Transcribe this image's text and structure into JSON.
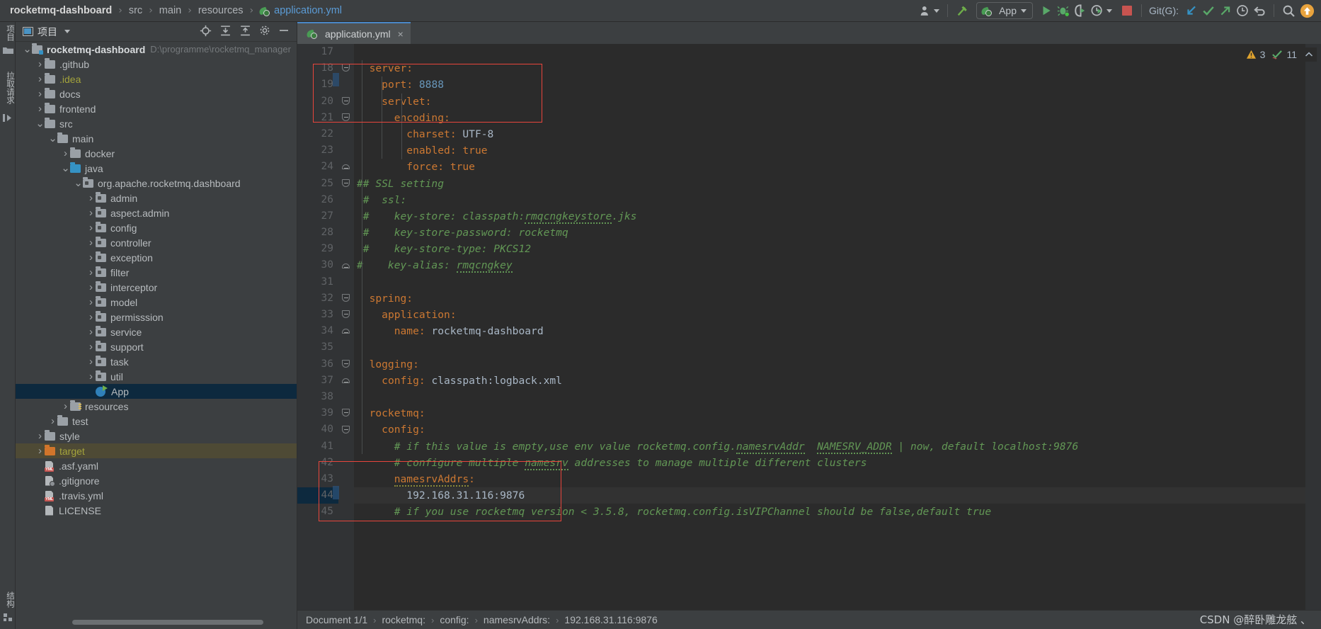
{
  "breadcrumb": {
    "items": [
      "rocketmq-dashboard",
      "src",
      "main",
      "resources",
      "application.yml"
    ],
    "separator": "›",
    "file_icon": "yaml-leaf-icon"
  },
  "toolbar": {
    "user_icon": "user-account-icon",
    "build_icon": "build-hammer-icon",
    "run_config_label": "App",
    "run_config_icon": "spring-leaf-icon",
    "run_icon": "run-play-icon",
    "debug_icon": "debug-bug-icon",
    "run_coverage_icon": "run-with-coverage-icon",
    "profiler_icon": "profiler-clock-icon",
    "stop_icon": "stop-square-icon",
    "git_label": "Git(G):",
    "git_update_icon": "git-update-arrow-icon",
    "git_commit_icon": "git-commit-check-icon",
    "git_push_icon": "git-push-arrow-icon",
    "git_history_icon": "git-history-clock-icon",
    "git_rollback_icon": "git-rollback-icon",
    "search_icon": "search-magnifier-icon",
    "notification_icon": "update-notification-icon"
  },
  "left_strip": {
    "tabs": [
      "项目",
      "拉取请求"
    ],
    "bottom_tabs": [
      "结构"
    ]
  },
  "project_panel": {
    "title": "项目",
    "header_icons": [
      "locate-target-icon",
      "expand-all-icon",
      "collapse-all-icon",
      "settings-gear-icon",
      "hide-minus-icon"
    ],
    "tree": [
      {
        "indent": 0,
        "arrow": "down",
        "icon": "module-folder",
        "label": "rocketmq-dashboard",
        "bold": true,
        "path": "D:\\programme\\rocketmq_manager"
      },
      {
        "indent": 1,
        "arrow": "right",
        "icon": "folder",
        "label": ".github"
      },
      {
        "indent": 1,
        "arrow": "right",
        "icon": "folder",
        "label": ".idea",
        "color": "yellow"
      },
      {
        "indent": 1,
        "arrow": "right",
        "icon": "folder",
        "label": "docs"
      },
      {
        "indent": 1,
        "arrow": "right",
        "icon": "folder",
        "label": "frontend"
      },
      {
        "indent": 1,
        "arrow": "down",
        "icon": "folder",
        "label": "src"
      },
      {
        "indent": 2,
        "arrow": "down",
        "icon": "folder",
        "label": "main"
      },
      {
        "indent": 3,
        "arrow": "right",
        "icon": "folder",
        "label": "docker"
      },
      {
        "indent": 3,
        "arrow": "down",
        "icon": "source-folder",
        "label": "java"
      },
      {
        "indent": 4,
        "arrow": "down",
        "icon": "package",
        "label": "org.apache.rocketmq.dashboard"
      },
      {
        "indent": 5,
        "arrow": "right",
        "icon": "package",
        "label": "admin"
      },
      {
        "indent": 5,
        "arrow": "right",
        "icon": "package",
        "label": "aspect.admin"
      },
      {
        "indent": 5,
        "arrow": "right",
        "icon": "package",
        "label": "config"
      },
      {
        "indent": 5,
        "arrow": "right",
        "icon": "package",
        "label": "controller"
      },
      {
        "indent": 5,
        "arrow": "right",
        "icon": "package",
        "label": "exception"
      },
      {
        "indent": 5,
        "arrow": "right",
        "icon": "package",
        "label": "filter"
      },
      {
        "indent": 5,
        "arrow": "right",
        "icon": "package",
        "label": "interceptor"
      },
      {
        "indent": 5,
        "arrow": "right",
        "icon": "package",
        "label": "model"
      },
      {
        "indent": 5,
        "arrow": "right",
        "icon": "package",
        "label": "permisssion"
      },
      {
        "indent": 5,
        "arrow": "right",
        "icon": "package",
        "label": "service"
      },
      {
        "indent": 5,
        "arrow": "right",
        "icon": "package",
        "label": "support"
      },
      {
        "indent": 5,
        "arrow": "right",
        "icon": "package",
        "label": "task"
      },
      {
        "indent": 5,
        "arrow": "right",
        "icon": "package",
        "label": "util"
      },
      {
        "indent": 5,
        "arrow": "none",
        "icon": "spring-class",
        "label": "App",
        "selected": true
      },
      {
        "indent": 3,
        "arrow": "right",
        "icon": "resource-folder",
        "label": "resources"
      },
      {
        "indent": 2,
        "arrow": "right",
        "icon": "folder",
        "label": "test"
      },
      {
        "indent": 1,
        "arrow": "right",
        "icon": "folder",
        "label": "style"
      },
      {
        "indent": 1,
        "arrow": "right",
        "icon": "target-folder",
        "label": "target",
        "color": "yellow",
        "highlighted": true
      },
      {
        "indent": 1,
        "arrow": "none",
        "icon": "yml-file",
        "label": ".asf.yaml"
      },
      {
        "indent": 1,
        "arrow": "none",
        "icon": "gitignore-file",
        "label": ".gitignore"
      },
      {
        "indent": 1,
        "arrow": "none",
        "icon": "yml-file",
        "label": ".travis.yml"
      },
      {
        "indent": 1,
        "arrow": "none",
        "icon": "text-file",
        "label": "LICENSE"
      }
    ]
  },
  "editor": {
    "tab": {
      "label": "application.yml",
      "icon": "yaml-leaf-icon",
      "close": "×"
    },
    "inspection": {
      "warning_icon": "warning-triangle-icon",
      "warning_count": "3",
      "ok_icon": "inspection-check-icon",
      "ok_count": "11",
      "collapse_icon": "chevron-up-icon"
    },
    "first_line": 17,
    "current_line": 44,
    "lines": [
      {
        "n": 17,
        "fold": "",
        "text": ""
      },
      {
        "n": 18,
        "fold": "open",
        "segs": [
          {
            "t": "  ",
            "c": ""
          },
          {
            "t": "server",
            "c": "key"
          },
          {
            "t": ":",
            "c": "key"
          }
        ]
      },
      {
        "n": 19,
        "fold": "",
        "segs": [
          {
            "t": "    ",
            "c": ""
          },
          {
            "t": "port",
            "c": "key"
          },
          {
            "t": ": ",
            "c": "key"
          },
          {
            "t": "8888",
            "c": "num"
          }
        ]
      },
      {
        "n": 20,
        "fold": "open",
        "segs": [
          {
            "t": "    ",
            "c": ""
          },
          {
            "t": "servlet",
            "c": "key"
          },
          {
            "t": ":",
            "c": "key"
          }
        ]
      },
      {
        "n": 21,
        "fold": "open",
        "segs": [
          {
            "t": "      ",
            "c": ""
          },
          {
            "t": "encoding",
            "c": "key"
          },
          {
            "t": ":",
            "c": "key"
          }
        ]
      },
      {
        "n": 22,
        "fold": "",
        "segs": [
          {
            "t": "        ",
            "c": ""
          },
          {
            "t": "charset",
            "c": "key"
          },
          {
            "t": ": ",
            "c": "key"
          },
          {
            "t": "UTF-8",
            "c": "val"
          }
        ]
      },
      {
        "n": 23,
        "fold": "",
        "segs": [
          {
            "t": "        ",
            "c": ""
          },
          {
            "t": "enabled",
            "c": "key"
          },
          {
            "t": ": ",
            "c": "key"
          },
          {
            "t": "true",
            "c": "key"
          }
        ]
      },
      {
        "n": 24,
        "fold": "end",
        "segs": [
          {
            "t": "        ",
            "c": ""
          },
          {
            "t": "force",
            "c": "key"
          },
          {
            "t": ": ",
            "c": "key"
          },
          {
            "t": "true",
            "c": "key"
          }
        ]
      },
      {
        "n": 25,
        "fold": "open",
        "segs": [
          {
            "t": "## SSL setting",
            "c": "cmt"
          }
        ]
      },
      {
        "n": 26,
        "fold": "",
        "segs": [
          {
            "t": " #  ssl:",
            "c": "cmt"
          }
        ]
      },
      {
        "n": 27,
        "fold": "",
        "segs": [
          {
            "t": " #    key-store: classpath:",
            "c": "cmt"
          },
          {
            "t": "rmqcngkeystore",
            "c": "cmt sq"
          },
          {
            "t": ".jks",
            "c": "cmt"
          }
        ]
      },
      {
        "n": 28,
        "fold": "",
        "segs": [
          {
            "t": " #    key-store-password: rocketmq",
            "c": "cmt"
          }
        ]
      },
      {
        "n": 29,
        "fold": "",
        "segs": [
          {
            "t": " #    key-store-type: PKCS12",
            "c": "cmt"
          }
        ]
      },
      {
        "n": 30,
        "fold": "end",
        "segs": [
          {
            "t": "#    key-alias: ",
            "c": "cmt"
          },
          {
            "t": "rmqcngkey",
            "c": "cmt sq"
          }
        ]
      },
      {
        "n": 31,
        "fold": "",
        "text": ""
      },
      {
        "n": 32,
        "fold": "open",
        "segs": [
          {
            "t": "  ",
            "c": ""
          },
          {
            "t": "spring",
            "c": "key"
          },
          {
            "t": ":",
            "c": "key"
          }
        ]
      },
      {
        "n": 33,
        "fold": "open",
        "segs": [
          {
            "t": "    ",
            "c": ""
          },
          {
            "t": "application",
            "c": "key"
          },
          {
            "t": ":",
            "c": "key"
          }
        ]
      },
      {
        "n": 34,
        "fold": "end",
        "segs": [
          {
            "t": "      ",
            "c": ""
          },
          {
            "t": "name",
            "c": "key"
          },
          {
            "t": ": ",
            "c": "key"
          },
          {
            "t": "rocketmq-dashboard",
            "c": "val"
          }
        ]
      },
      {
        "n": 35,
        "fold": "",
        "text": ""
      },
      {
        "n": 36,
        "fold": "open",
        "segs": [
          {
            "t": "  ",
            "c": ""
          },
          {
            "t": "logging",
            "c": "key"
          },
          {
            "t": ":",
            "c": "key"
          }
        ]
      },
      {
        "n": 37,
        "fold": "end",
        "segs": [
          {
            "t": "    ",
            "c": ""
          },
          {
            "t": "config",
            "c": "key"
          },
          {
            "t": ": ",
            "c": "key"
          },
          {
            "t": "classpath:logback.xml",
            "c": "val"
          }
        ]
      },
      {
        "n": 38,
        "fold": "",
        "text": ""
      },
      {
        "n": 39,
        "fold": "open",
        "segs": [
          {
            "t": "  ",
            "c": ""
          },
          {
            "t": "rocketmq",
            "c": "key"
          },
          {
            "t": ":",
            "c": "key"
          }
        ]
      },
      {
        "n": 40,
        "fold": "open",
        "segs": [
          {
            "t": "    ",
            "c": ""
          },
          {
            "t": "config",
            "c": "key"
          },
          {
            "t": ":",
            "c": "key"
          }
        ]
      },
      {
        "n": 41,
        "fold": "",
        "segs": [
          {
            "t": "      # if this value is empty,use env value rocketmq.config.",
            "c": "cmt"
          },
          {
            "t": "namesrvAddr",
            "c": "cmt sq"
          },
          {
            "t": "  ",
            "c": "cmt"
          },
          {
            "t": "NAMESRV_ADDR",
            "c": "cmt sq"
          },
          {
            "t": " | now, default localhost:9876",
            "c": "cmt"
          }
        ]
      },
      {
        "n": 42,
        "fold": "",
        "segs": [
          {
            "t": "      # configure multiple ",
            "c": "cmt"
          },
          {
            "t": "namesrv",
            "c": "cmt sq"
          },
          {
            "t": " addresses to manage multiple different clusters",
            "c": "cmt"
          }
        ]
      },
      {
        "n": 43,
        "fold": "",
        "segs": [
          {
            "t": "      ",
            "c": ""
          },
          {
            "t": "namesrvAddrs",
            "c": "key sqo"
          },
          {
            "t": ":",
            "c": "key"
          }
        ]
      },
      {
        "n": 44,
        "fold": "",
        "current": true,
        "segs": [
          {
            "t": "        192.168.31.116:9876",
            "c": "val"
          }
        ]
      },
      {
        "n": 45,
        "fold": "",
        "segs": [
          {
            "t": "      # if you use rocketmq version < 3.5.8, rocketmq.config.isVIPChannel should be false,default true",
            "c": "cmt"
          }
        ]
      }
    ]
  },
  "status_bar": {
    "document": "Document 1/1",
    "path": [
      "rocketmq:",
      "config:",
      "namesrvAddrs:",
      "192.168.31.116:9876"
    ],
    "separator": "›"
  },
  "watermark": "CSDN @醉卧雕龙舷 、",
  "colors": {
    "accent": "#4a88c7",
    "keyword": "#cc7832",
    "comment": "#629755",
    "number": "#6897bb",
    "editor_bg": "#2b2b2b",
    "panel_bg": "#3c3f41",
    "selection": "#0d293e",
    "highlight_box": "#e8453c"
  }
}
